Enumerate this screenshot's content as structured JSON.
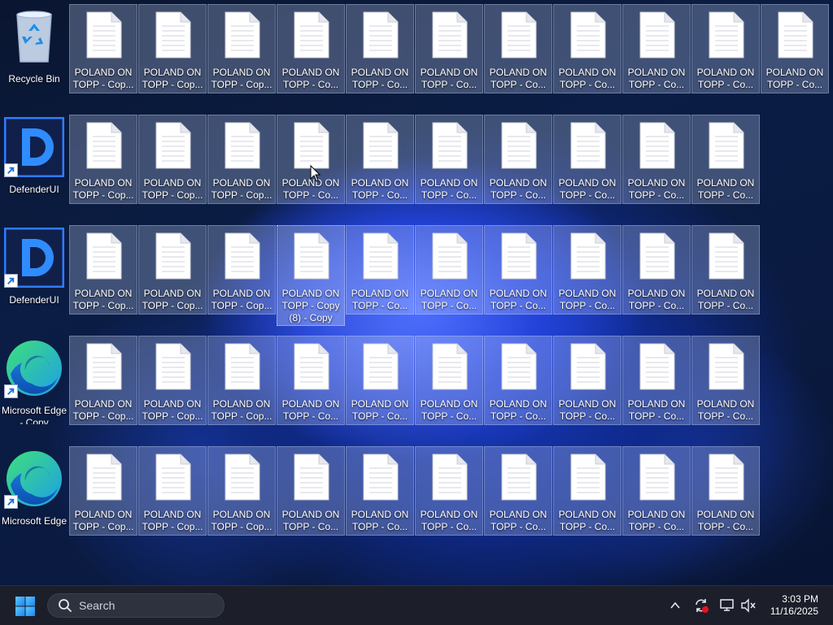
{
  "desktop": {
    "system_icons": [
      {
        "name": "recycle-bin",
        "label": "Recycle Bin",
        "type": "recycle"
      },
      {
        "name": "defender-shortcut-1",
        "label": "DefenderUI",
        "type": "defender"
      },
      {
        "name": "defender-shortcut-2",
        "label": "DefenderUI",
        "type": "defender"
      },
      {
        "name": "edge-copy-shortcut",
        "label": "Microsoft Edge - Copy",
        "type": "edge"
      },
      {
        "name": "edge-shortcut",
        "label": "Microsoft Edge",
        "type": "edge"
      }
    ],
    "file_rows": [
      {
        "columns": 11,
        "selected": 11,
        "labels": [
          "POLAND ON TOPP - Cop...",
          "POLAND ON TOPP - Cop...",
          "POLAND ON TOPP - Cop...",
          "POLAND ON TOPP - Co...",
          "POLAND ON TOPP - Co...",
          "POLAND ON TOPP - Co...",
          "POLAND ON TOPP - Co...",
          "POLAND ON TOPP - Co...",
          "POLAND ON TOPP - Co...",
          "POLAND ON TOPP - Co...",
          "POLAND ON TOPP - Co..."
        ]
      },
      {
        "columns": 10,
        "selected": 10,
        "labels": [
          "POLAND ON TOPP - Cop...",
          "POLAND ON TOPP - Cop...",
          "POLAND ON TOPP - Cop...",
          "POLAND ON TOPP - Co...",
          "POLAND ON TOPP - Co...",
          "POLAND ON TOPP - Co...",
          "POLAND ON TOPP - Co...",
          "POLAND ON TOPP - Co...",
          "POLAND ON TOPP - Co...",
          "POLAND ON TOPP - Co..."
        ]
      },
      {
        "columns": 10,
        "selected": 10,
        "focused": 3,
        "labels": [
          "POLAND ON TOPP - Cop...",
          "POLAND ON TOPP - Cop...",
          "POLAND ON TOPP - Cop...",
          "POLAND ON TOPP - Copy (8) - Copy",
          "POLAND ON TOPP - Co...",
          "POLAND ON TOPP - Co...",
          "POLAND ON TOPP - Co...",
          "POLAND ON TOPP - Co...",
          "POLAND ON TOPP - Co...",
          "POLAND ON TOPP - Co..."
        ]
      },
      {
        "columns": 10,
        "selected": 10,
        "labels": [
          "POLAND ON TOPP - Cop...",
          "POLAND ON TOPP - Cop...",
          "POLAND ON TOPP - Cop...",
          "POLAND ON TOPP - Co...",
          "POLAND ON TOPP - Co...",
          "POLAND ON TOPP - Co...",
          "POLAND ON TOPP - Co...",
          "POLAND ON TOPP - Co...",
          "POLAND ON TOPP - Co...",
          "POLAND ON TOPP - Co..."
        ]
      },
      {
        "columns": 10,
        "selected": 10,
        "labels": [
          "POLAND ON TOPP - Cop...",
          "POLAND ON TOPP - Cop...",
          "POLAND ON TOPP - Cop...",
          "POLAND ON TOPP - Co...",
          "POLAND ON TOPP - Co...",
          "POLAND ON TOPP - Co...",
          "POLAND ON TOPP - Co...",
          "POLAND ON TOPP - Co...",
          "POLAND ON TOPP - Co...",
          "POLAND ON TOPP - Co..."
        ]
      }
    ]
  },
  "taskbar": {
    "start_icon": "windows-logo-icon",
    "search_placeholder": "Search",
    "tray_icons": [
      "chevron-up-icon",
      "sync-alert-icon",
      "display-icon",
      "volume-muted-icon"
    ],
    "time": "3:03 PM",
    "date": "11/16/2025"
  },
  "colors": {
    "accent": "#1e5eff",
    "taskbar": "#1c1f2a",
    "selection": "#cddcff"
  }
}
